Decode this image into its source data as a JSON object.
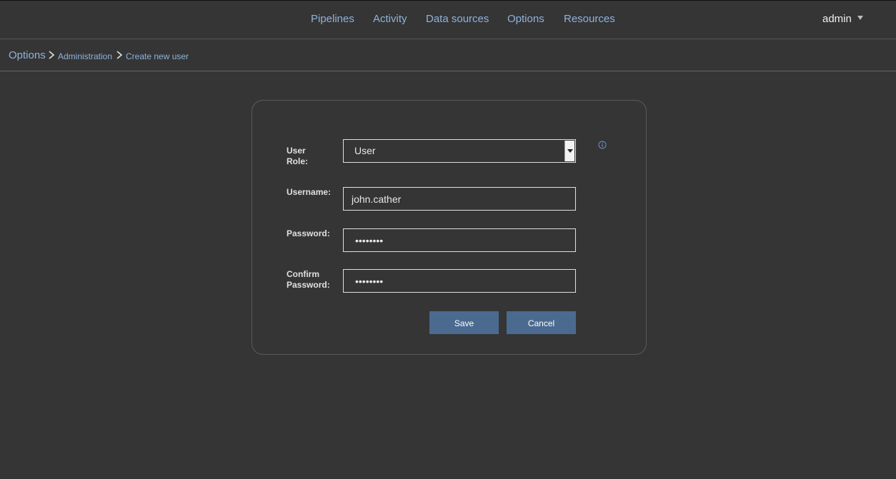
{
  "nav": {
    "items": [
      {
        "label": "Pipelines"
      },
      {
        "label": "Activity"
      },
      {
        "label": "Data sources"
      },
      {
        "label": "Options"
      },
      {
        "label": "Resources"
      }
    ],
    "user": "admin"
  },
  "breadcrumb": {
    "root": "Options",
    "level1": "Administration",
    "level2": "Create new user"
  },
  "form": {
    "role_label_line1": "User",
    "role_label_line2": "Role:",
    "role_value": "User",
    "username_label": "Username:",
    "username_value": "john.cather",
    "password_label": "Password:",
    "password_value": "••••••••",
    "confirm_label_line1": "Confirm",
    "confirm_label_line2": "Password:",
    "confirm_value": "••••••••",
    "save_label": "Save",
    "cancel_label": "Cancel",
    "info_icon": "info-circle-icon"
  },
  "colors": {
    "background": "#353535",
    "link": "#8fb2dc",
    "button": "#4b6a8f"
  }
}
